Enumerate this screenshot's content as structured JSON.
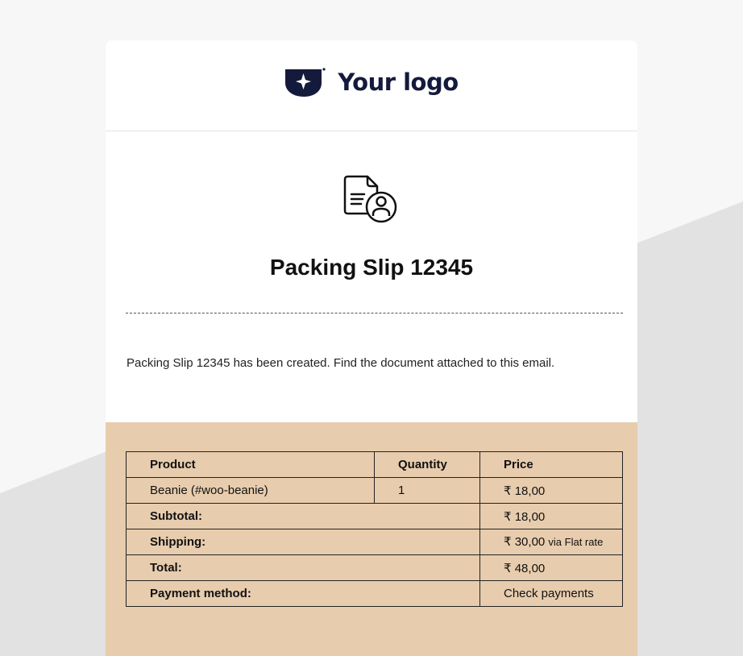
{
  "logo": {
    "text": "Your logo"
  },
  "email": {
    "title": "Packing Slip 12345",
    "message": "Packing Slip 12345 has been created. Find the document attached to this email."
  },
  "table": {
    "headers": {
      "product": "Product",
      "quantity": "Quantity",
      "price": "Price"
    },
    "items": [
      {
        "product": "Beanie (#woo-beanie)",
        "quantity": "1",
        "price": "₹ 18,00"
      }
    ],
    "subtotal": {
      "label": "Subtotal:",
      "value": "₹ 18,00"
    },
    "shipping": {
      "label": "Shipping:",
      "value": "₹ 30,00",
      "note": "via Flat rate"
    },
    "total": {
      "label": "Total:",
      "value": "₹ 48,00"
    },
    "payment": {
      "label": "Payment method:",
      "value": "Check payments"
    }
  },
  "colors": {
    "page_bg": "#f7f7f7",
    "wedge": "#e2e2e2",
    "card_bg": "#ffffff",
    "summary_bg": "#e8ccae",
    "logo_navy": "#141a3b"
  },
  "icons": {
    "logo_mark": "shield-star-icon",
    "document": "document-user-icon"
  }
}
